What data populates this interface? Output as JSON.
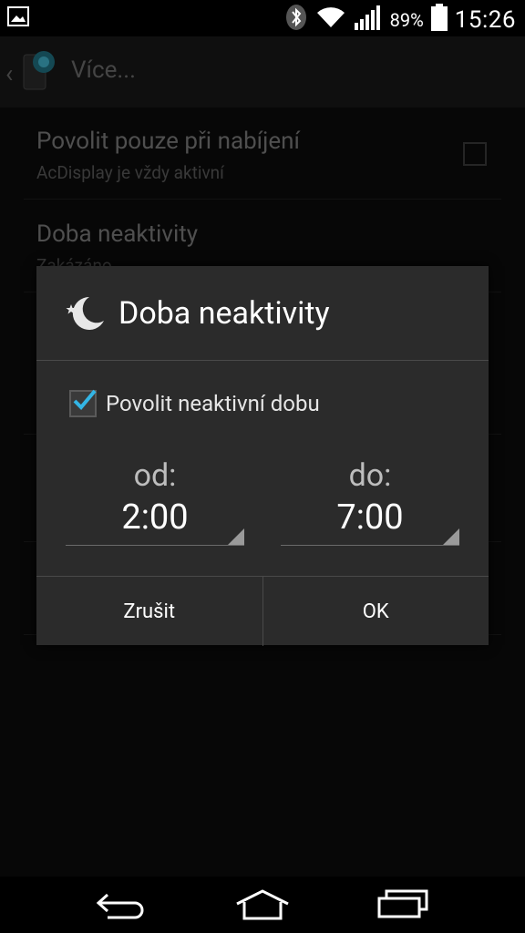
{
  "status_bar": {
    "battery_percent": "89%",
    "time": "15:26",
    "icons": [
      "image-icon",
      "bluetooth-icon",
      "wifi-icon",
      "signal-icon",
      "battery-icon"
    ]
  },
  "action_bar": {
    "title": "Více..."
  },
  "preferences": [
    {
      "title": "Povolit pouze při nabíjení",
      "summary": "AcDisplay je vždy aktivní"
    },
    {
      "title": "Doba neaktivity",
      "summary": "Zakázáno"
    }
  ],
  "dialog": {
    "title": "Doba neaktivity",
    "checkbox_label": "Povolit neaktivní dobu",
    "checkbox_checked": true,
    "from": {
      "label": "od:",
      "value": "2:00"
    },
    "to": {
      "label": "do:",
      "value": "7:00"
    },
    "cancel_label": "Zrušit",
    "ok_label": "OK"
  },
  "colors": {
    "accent": "#33b5e5",
    "dialog_bg": "#2b2b2b"
  }
}
